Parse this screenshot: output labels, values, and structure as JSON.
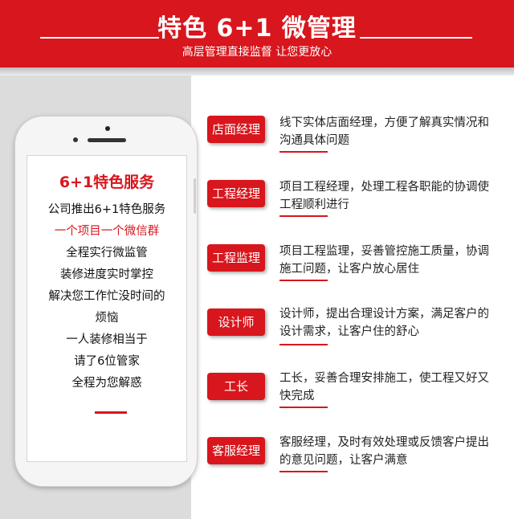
{
  "header": {
    "title": "特色 6+1 微管理",
    "subtitle": "高层管理直接监督  让您更放心",
    "color": "#d8161d"
  },
  "phone": {
    "heading": "6+1特色服务",
    "lines": [
      "公司推出6+1特色服务",
      "一个项目一个微信群",
      "全程实行微监管",
      "装修进度实时掌控",
      "解决您工作忙没时间的",
      "烦恼",
      "一人装修相当于",
      "请了6位管家",
      "全程为您解惑"
    ]
  },
  "roles": [
    {
      "label": "店面经理",
      "desc": "线下实体店面经理，方便了解真实情况和沟通具体问题"
    },
    {
      "label": "工程经理",
      "desc": "项目工程经理，处理工程各职能的协调使工程顺利进行"
    },
    {
      "label": "工程监理",
      "desc": "项目工程监理，妥善管控施工质量，协调施工问题，让客户放心居住"
    },
    {
      "label": "设计师",
      "desc": "设计师，提出合理设计方案，满足客户的设计需求，让客户住的舒心"
    },
    {
      "label": "工长",
      "desc": "工长，妥善合理安排施工，使工程又好又快完成"
    },
    {
      "label": "客服经理",
      "desc": "客服经理，及时有效处理或反馈客户提出的意见问题，让客户满意"
    }
  ]
}
